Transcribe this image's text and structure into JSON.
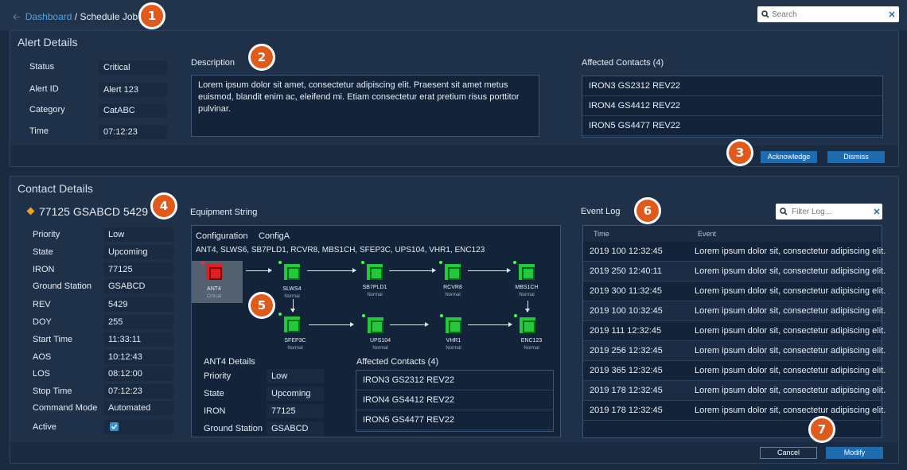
{
  "breadcrumb": {
    "root": "Dashboard",
    "separator": " / ",
    "current": "Schedule Job"
  },
  "search": {
    "placeholder": "Search"
  },
  "badges": [
    "1",
    "2",
    "3",
    "4",
    "5",
    "6",
    "7"
  ],
  "alert": {
    "title": "Alert Details",
    "fields": [
      {
        "label": "Status",
        "value": "Critical"
      },
      {
        "label": "Alert ID",
        "value": "Alert 123"
      },
      {
        "label": "Category",
        "value": "CatABC"
      },
      {
        "label": "Time",
        "value": "07:12:23"
      }
    ],
    "description_label": "Description",
    "description": "Lorem ipsum dolor sit amet, consectetur adipiscing elit. Praesent sit amet metus euismod, blandit enim ac, eleifend mi. Etiam consectetur erat pretium risus porttitor pulvinar.",
    "contacts_label": "Affected Contacts (4)",
    "contacts": [
      "IRON3 GS2312 REV22",
      "IRON4 GS4412 REV22",
      "IRON5 GS4477 REV22"
    ],
    "acknowledge": "Acknowledge",
    "dismiss": "Dismiss"
  },
  "contact": {
    "title": "Contact Details",
    "name": "77125 GSABCD 5429",
    "fields": [
      {
        "label": "Priority",
        "value": "Low"
      },
      {
        "label": "State",
        "value": "Upcoming"
      },
      {
        "label": "IRON",
        "value": "77125"
      },
      {
        "label": "Ground Station",
        "value": "GSABCD"
      },
      {
        "label": "REV",
        "value": "5429"
      },
      {
        "label": "DOY",
        "value": "255"
      },
      {
        "label": "Start Time",
        "value": "11:33:11"
      },
      {
        "label": "AOS",
        "value": "10:12:43"
      },
      {
        "label": "LOS",
        "value": "08:12:00"
      },
      {
        "label": "Stop Time",
        "value": "07:12:23"
      },
      {
        "label": "Command Mode",
        "value": "Automated"
      }
    ],
    "active_label": "Active",
    "active_checked": true,
    "cancel": "Cancel",
    "modify": "Modify"
  },
  "equipment": {
    "title": "Equipment String",
    "config_label": "Configuration",
    "config_value": "ConfigA",
    "string": "ANT4, SLWS6, SB7PLD1, RCVR8, MBS1CH, SFEP3C, UPS104, VHR1, ENC123",
    "nodes": [
      {
        "name": "ANT4",
        "status": "Critical"
      },
      {
        "name": "SLWS4",
        "status": "Normal"
      },
      {
        "name": "SB7PLD1",
        "status": "Normal"
      },
      {
        "name": "RCVR8",
        "status": "Normal"
      },
      {
        "name": "MBS1CH",
        "status": "Normal"
      },
      {
        "name": "SFEP3C",
        "status": "Normal"
      },
      {
        "name": "UPS104",
        "status": "Normal"
      },
      {
        "name": "VHR1",
        "status": "Normal"
      },
      {
        "name": "ENC123",
        "status": "Normal"
      }
    ],
    "details_title": "ANT4 Details",
    "details": [
      {
        "label": "Priority",
        "value": "Low"
      },
      {
        "label": "State",
        "value": "Upcoming"
      },
      {
        "label": "IRON",
        "value": "77125"
      },
      {
        "label": "Ground Station",
        "value": "GSABCD"
      }
    ],
    "contacts_label": "Affected Contacts (4)",
    "contacts": [
      "IRON3 GS2312 REV22",
      "IRON4 GS4412 REV22",
      "IRON5 GS4477 REV22"
    ]
  },
  "eventlog": {
    "title": "Event Log",
    "filter_placeholder": "Filter Log...",
    "col_time": "Time",
    "col_event": "Event",
    "rows": [
      {
        "time": "2019 100 12:32:45",
        "event": "Lorem ipsum dolor sit, consectetur adipiscing elit."
      },
      {
        "time": "2019 250 12:40:11",
        "event": "Lorem ipsum dolor sit, consectetur adipiscing elit."
      },
      {
        "time": "2019 300 11:32:45",
        "event": "Lorem ipsum dolor sit, consectetur adipiscing elit."
      },
      {
        "time": "2019 100 10:32:45",
        "event": "Lorem ipsum dolor sit, consectetur adipiscing elit."
      },
      {
        "time": "2019 111 12:32:45",
        "event": "Lorem ipsum dolor sit, consectetur adipiscing elit."
      },
      {
        "time": "2019 256 12:32:45",
        "event": "Lorem ipsum dolor sit, consectetur adipiscing elit."
      },
      {
        "time": "2019 365 12:32:45",
        "event": "Lorem ipsum dolor sit, consectetur adipiscing elit."
      },
      {
        "time": "2019 178 12:32:45",
        "event": "Lorem ipsum dolor sit, consectetur adipiscing elit."
      },
      {
        "time": "2019 178 12:32:45",
        "event": "Lorem ipsum dolor sit, consectetur adipiscing elit."
      }
    ]
  },
  "colors": {
    "accent": "#1f6bb0",
    "badge": "#e05a1c",
    "normal": "#22c93a",
    "critical": "#e02020",
    "status_orange": "#f0a020"
  }
}
